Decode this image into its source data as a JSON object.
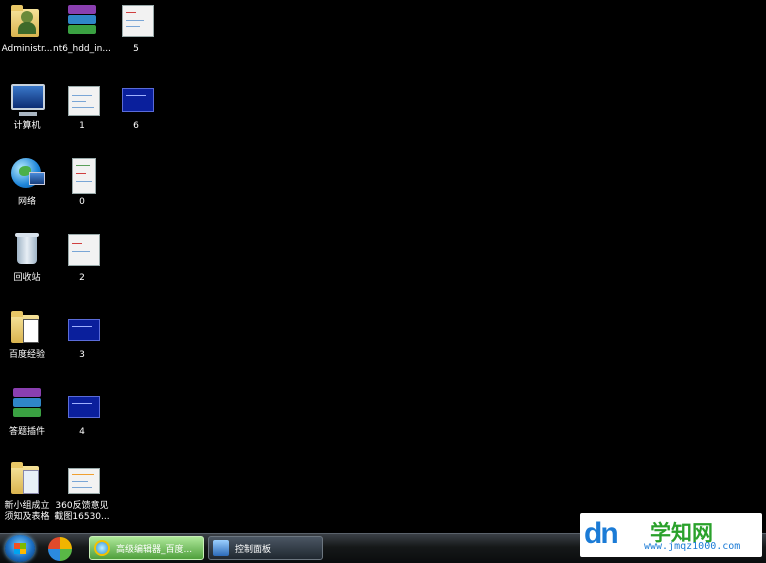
{
  "desktop": {
    "icons": [
      {
        "label": "Administr...",
        "icon": "user-folder-icon"
      },
      {
        "label": "nt6_hdd_in...",
        "icon": "winrar-archive-icon"
      },
      {
        "label": "5",
        "icon": "image-thumbnail-icon"
      },
      {
        "label": "计算机",
        "icon": "computer-icon"
      },
      {
        "label": "1",
        "icon": "image-thumbnail-icon"
      },
      {
        "label": "6",
        "icon": "image-thumbnail-icon"
      },
      {
        "label": "网络",
        "icon": "network-globe-icon"
      },
      {
        "label": "0",
        "icon": "image-thumbnail-icon"
      },
      {
        "label": "回收站",
        "icon": "recycle-bin-icon"
      },
      {
        "label": "2",
        "icon": "image-thumbnail-icon"
      },
      {
        "label": "百度经验",
        "icon": "folder-icon"
      },
      {
        "label": "3",
        "icon": "image-thumbnail-icon"
      },
      {
        "label": "答题插件",
        "icon": "winrar-archive-icon"
      },
      {
        "label": "4",
        "icon": "image-thumbnail-icon"
      },
      {
        "label": "新小组成立须知及表格",
        "icon": "folder-icon"
      },
      {
        "label": "360反馈意见截图16530...",
        "icon": "image-thumbnail-icon"
      }
    ]
  },
  "taskbar": {
    "start_icon": "windows-start-orb",
    "quick_launch_icon": "360-security-icon",
    "tasks": [
      {
        "label": "高级编辑器_百度...",
        "icon": "internet-explorer-icon",
        "active": true
      },
      {
        "label": "控制面板",
        "icon": "control-panel-icon",
        "active": false
      }
    ]
  },
  "watermark": {
    "logo": "dn",
    "title": "学知网",
    "url": "www.jmqz1000.com"
  }
}
